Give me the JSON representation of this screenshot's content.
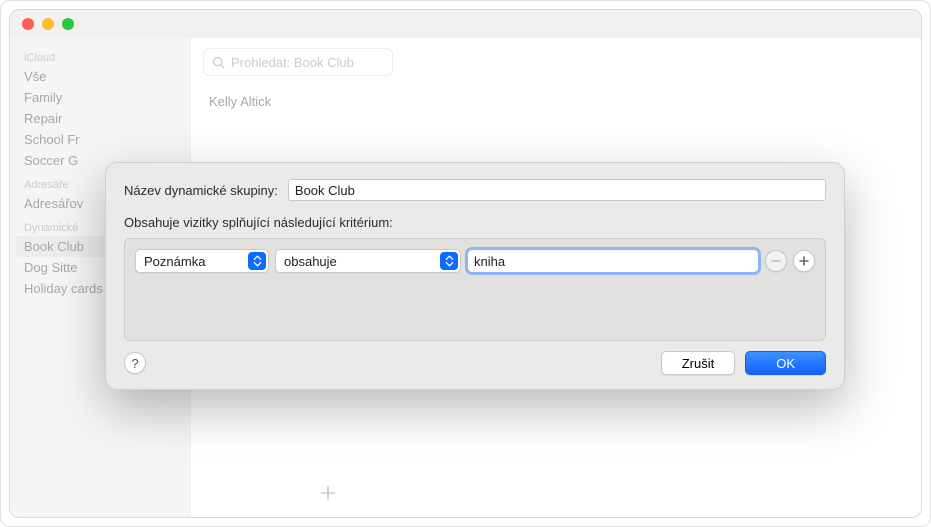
{
  "sidebar": {
    "sections": [
      {
        "heading": "iCloud",
        "items": [
          "Vše",
          "Family",
          "Repair",
          "School Fr",
          "Soccer G"
        ]
      },
      {
        "heading": "Adresáře",
        "items": [
          "Adresářov"
        ]
      },
      {
        "heading": "Dynamické",
        "items": [
          "Book Club",
          "Dog Sitte",
          "Holiday cards"
        ],
        "selected_index": 0
      }
    ]
  },
  "search": {
    "placeholder": "Prohledat: Book Club"
  },
  "list": {
    "rows": [
      "Kelly Altick"
    ]
  },
  "dialog": {
    "name_label": "Název dynamické skupiny:",
    "name_value": "Book Club",
    "criteria_label": "Obsahuje vizitky splňující následující kritérium:",
    "criterion": {
      "field": "Poznámka",
      "operator": "obsahuje",
      "value": "kniha"
    },
    "help": "?",
    "cancel": "Zrušit",
    "ok": "OK"
  }
}
